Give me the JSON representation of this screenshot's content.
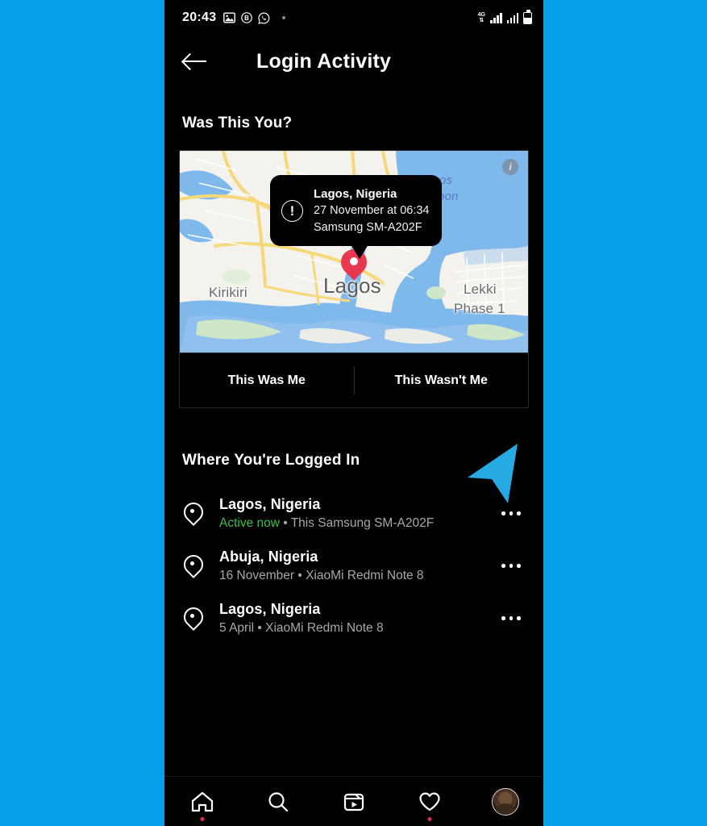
{
  "background_color": "#05A0E8",
  "statusbar": {
    "time": "20:43",
    "left_icons": [
      "gallery-icon",
      "b-badge-icon",
      "whatsapp-icon",
      "dot-indicator"
    ],
    "network_top": "4G",
    "network_bottom": "⇅",
    "right_icons": [
      "signal-bars-1",
      "signal-bars-2",
      "battery-icon"
    ]
  },
  "header": {
    "back_icon": "back-arrow-icon",
    "title": "Login Activity"
  },
  "sections": {
    "was_this_you": "Was This You?",
    "where_logged_in": "Where You're Logged In"
  },
  "alert_card": {
    "map": {
      "info_icon_label": "i",
      "labels": [
        {
          "text": "Kirikiri",
          "style": "land"
        },
        {
          "text": "Lagos",
          "style": "city"
        },
        {
          "text": "Lekki",
          "style": "land"
        },
        {
          "text": "Phase 1",
          "style": "land"
        },
        {
          "text": "os",
          "style": "water"
        },
        {
          "text": "oon",
          "style": "water"
        }
      ],
      "pin_color": "#E8384F",
      "water_color": "#7FB8EB",
      "road_color": "#F5D87A",
      "land_color": "#F4F2ED",
      "park_color": "#CFE6C8"
    },
    "tooltip": {
      "icon": "exclamation-circle-icon",
      "location": "Lagos, Nigeria",
      "datetime": "27 November at 06:34",
      "device": "Samsung SM-A202F"
    },
    "buttons": {
      "confirm": "This Was Me",
      "deny": "This Wasn't Me"
    }
  },
  "sessions": [
    {
      "location": "Lagos, Nigeria",
      "status": "Active now",
      "separator": " • ",
      "device": "This Samsung SM-A202F",
      "status_color": "#3FBE4E",
      "more_label": "…"
    },
    {
      "location": "Abuja, Nigeria",
      "status": "16 November",
      "separator": " • ",
      "device": "XiaoMi Redmi Note 8",
      "status_color": "#a8a8a8",
      "more_label": "…"
    },
    {
      "location": "Lagos, Nigeria",
      "status": "5 April",
      "separator": " • ",
      "device": "XiaoMi Redmi Note 8",
      "status_color": "#a8a8a8",
      "more_label": "…"
    }
  ],
  "annotation": {
    "arrow_color": "#27A9E1",
    "points_to": "session-0-more-button"
  },
  "bottomnav": {
    "items": [
      {
        "icon": "home-icon",
        "badge": true
      },
      {
        "icon": "search-icon",
        "badge": false
      },
      {
        "icon": "reels-icon",
        "badge": false
      },
      {
        "icon": "heart-icon",
        "badge": true
      },
      {
        "icon": "profile-avatar",
        "badge": false
      }
    ]
  }
}
